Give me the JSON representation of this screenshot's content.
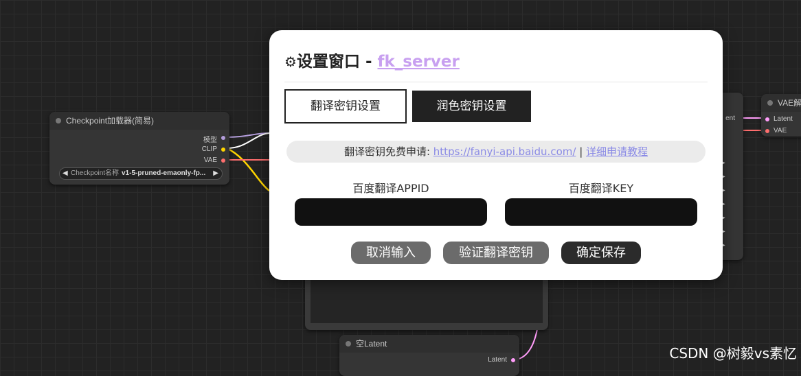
{
  "canvas": {
    "checkpoint_node": {
      "title": "Checkpoint加载器(简易)",
      "outputs": [
        "模型",
        "CLIP",
        "VAE"
      ],
      "widget_label": "Checkpoint名称",
      "widget_value": "v1-5-pruned-emaonly-fp...",
      "arrow_left": "◀",
      "arrow_right": "▶"
    },
    "vae_node": {
      "title": "VAE解",
      "inputs": [
        "Latent",
        "VAE"
      ]
    },
    "middle_node": {
      "partial_label": "ent"
    },
    "latent_node": {
      "title": "空Latent",
      "output": "Latent"
    },
    "play_glyph": "▶",
    "colors": {
      "model_pin": "#b39ddb",
      "clip_pin": "#ffd500",
      "vae_pin": "#ff6e6e",
      "latent_pin": "#ff9cf9"
    }
  },
  "modal": {
    "gear_icon": "⚙",
    "title": "设置窗口 - ",
    "title_link": "fk_server",
    "tabs": [
      {
        "label": "翻译密钥设置"
      },
      {
        "label": "润色密钥设置"
      }
    ],
    "apply": {
      "prefix": "翻译密钥免费申请: ",
      "url": "https://fanyi-api.baidu.com/",
      "separator": " | ",
      "tutorial": "详细申请教程"
    },
    "fields": [
      {
        "label": "百度翻译APPID",
        "value": "",
        "placeholder": ""
      },
      {
        "label": "百度翻译KEY",
        "value": "",
        "placeholder": ""
      }
    ],
    "buttons": {
      "cancel": "取消输入",
      "verify": "验证翻译密钥",
      "save": "确定保存"
    }
  },
  "watermark": "CSDN @树毅vs素忆"
}
